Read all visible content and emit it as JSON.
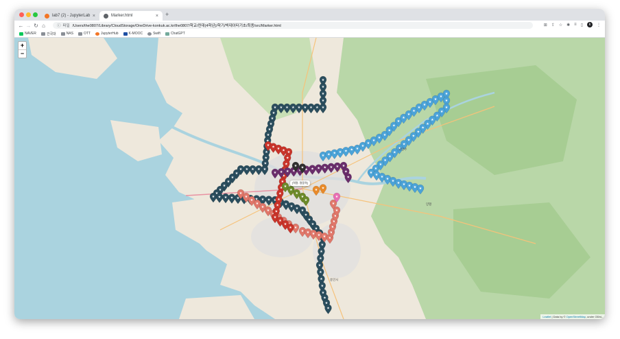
{
  "browser": {
    "tabs": [
      {
        "title": "lab7 (2) - JupyterLab",
        "active": false,
        "favicon_color": "#f37626"
      },
      {
        "title": "Marker.html",
        "active": true,
        "favicon_color": "#5f6368"
      }
    ],
    "new_tab": "+",
    "address": {
      "scheme": "파일",
      "url": "/Users/the0807/Library/CloudStorage/OneDrive-konkuk.ac.kr/the0807/학교/컨대(4학년)/학기/빅데이터기초/최종/src/Marker.html"
    },
    "profile_initial": "k",
    "bookmarks": [
      {
        "label": "NAVER",
        "color": "#03c75a"
      },
      {
        "label": "건국대",
        "color": "#8a8f96"
      },
      {
        "label": "NAS",
        "color": "#8a8f96"
      },
      {
        "label": "OTT",
        "color": "#8a8f96"
      },
      {
        "label": "JupyterHub",
        "color": "#f37626"
      },
      {
        "label": "K-MOOC",
        "color": "#1e4fa3"
      },
      {
        "label": "Swift",
        "color": "#8a8f96"
      },
      {
        "label": "ChatGPT",
        "color": "#74aa9c"
      }
    ]
  },
  "map": {
    "zoom_in": "+",
    "zoom_out": "−",
    "attribution": {
      "leaflet": "Leaflet",
      "separator": " | Data by © ",
      "osm": "OpenStreetMap",
      "suffix": ", under ODbL."
    },
    "popup": "[역명: 명동역]",
    "colors": {
      "sea": "#aad3df",
      "land": "#f2efe9",
      "forest": "#add19e",
      "urban": "#e0dfdf"
    },
    "marker_lines": [
      {
        "icon": "star-icon",
        "color": "#2a4d5d"
      },
      {
        "icon": "star-icon",
        "color": "#e0776a"
      },
      {
        "icon": "star-icon",
        "color": "#4ba3d8"
      },
      {
        "icon": "star-icon",
        "color": "#c9342a"
      },
      {
        "icon": "star-icon",
        "color": "#6a2d6b"
      },
      {
        "icon": "star-icon",
        "color": "#6c8a2a"
      },
      {
        "icon": "star-icon",
        "color": "#e88a2a"
      },
      {
        "icon": "star-icon",
        "color": "#e86fb3"
      },
      {
        "icon": "star-icon",
        "color": "#2f2f2f"
      }
    ]
  }
}
